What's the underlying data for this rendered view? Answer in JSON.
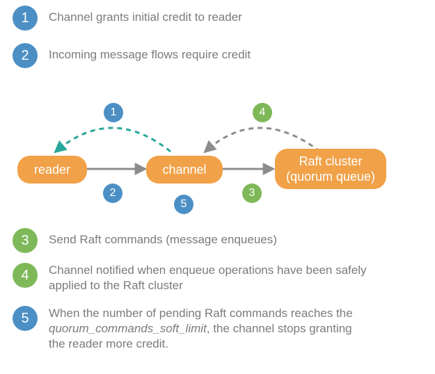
{
  "legend": {
    "r1": {
      "num": "1",
      "text": "Channel grants initial credit to reader"
    },
    "r2": {
      "num": "2",
      "text": "Incoming message flows require credit"
    },
    "r3": {
      "num": "3",
      "text": "Send Raft commands (message enqueues)"
    },
    "r4": {
      "num": "4",
      "text": "Channel notified when enqueue operations have been safely applied to the Raft cluster"
    },
    "r5": {
      "num": "5",
      "text_a": "When the number of pending Raft commands reaches the ",
      "text_em": "quorum_commands_soft_limit",
      "text_b": ", the channel stops granting the reader more credit."
    }
  },
  "nodes": {
    "reader": {
      "label": "reader"
    },
    "channel": {
      "label": "channel"
    },
    "cluster": {
      "line1": "Raft cluster",
      "line2": "(quorum queue)"
    }
  },
  "mini": {
    "m1": "1",
    "m2": "2",
    "m3": "3",
    "m4": "4",
    "m5": "5"
  },
  "colors": {
    "blue": "#4c8fc4",
    "green": "#7eb858",
    "orange": "#f1a148",
    "gray": "#8c8c8c",
    "teal": "#2aa79b"
  },
  "chart_data": {
    "type": "diagram",
    "nodes": [
      "reader",
      "channel",
      "Raft cluster (quorum queue)"
    ],
    "edges": [
      {
        "from": "channel",
        "to": "reader",
        "label": 1,
        "style": "dashed-teal",
        "meaning": "Channel grants initial credit to reader"
      },
      {
        "from": "reader",
        "to": "channel",
        "label": 2,
        "style": "solid-gray",
        "meaning": "Incoming message flows require credit"
      },
      {
        "from": "channel",
        "to": "Raft cluster (quorum queue)",
        "label": 3,
        "style": "solid-gray",
        "meaning": "Send Raft commands (message enqueues)"
      },
      {
        "from": "Raft cluster (quorum queue)",
        "to": "channel",
        "label": 4,
        "style": "dashed-gray",
        "meaning": "Channel notified when enqueue operations have been safely applied to the Raft cluster"
      },
      {
        "from": "channel",
        "to": "reader",
        "label": 5,
        "style": "implied",
        "meaning": "When the number of pending Raft commands reaches the quorum_commands_soft_limit, the channel stops granting the reader more credit."
      }
    ]
  }
}
